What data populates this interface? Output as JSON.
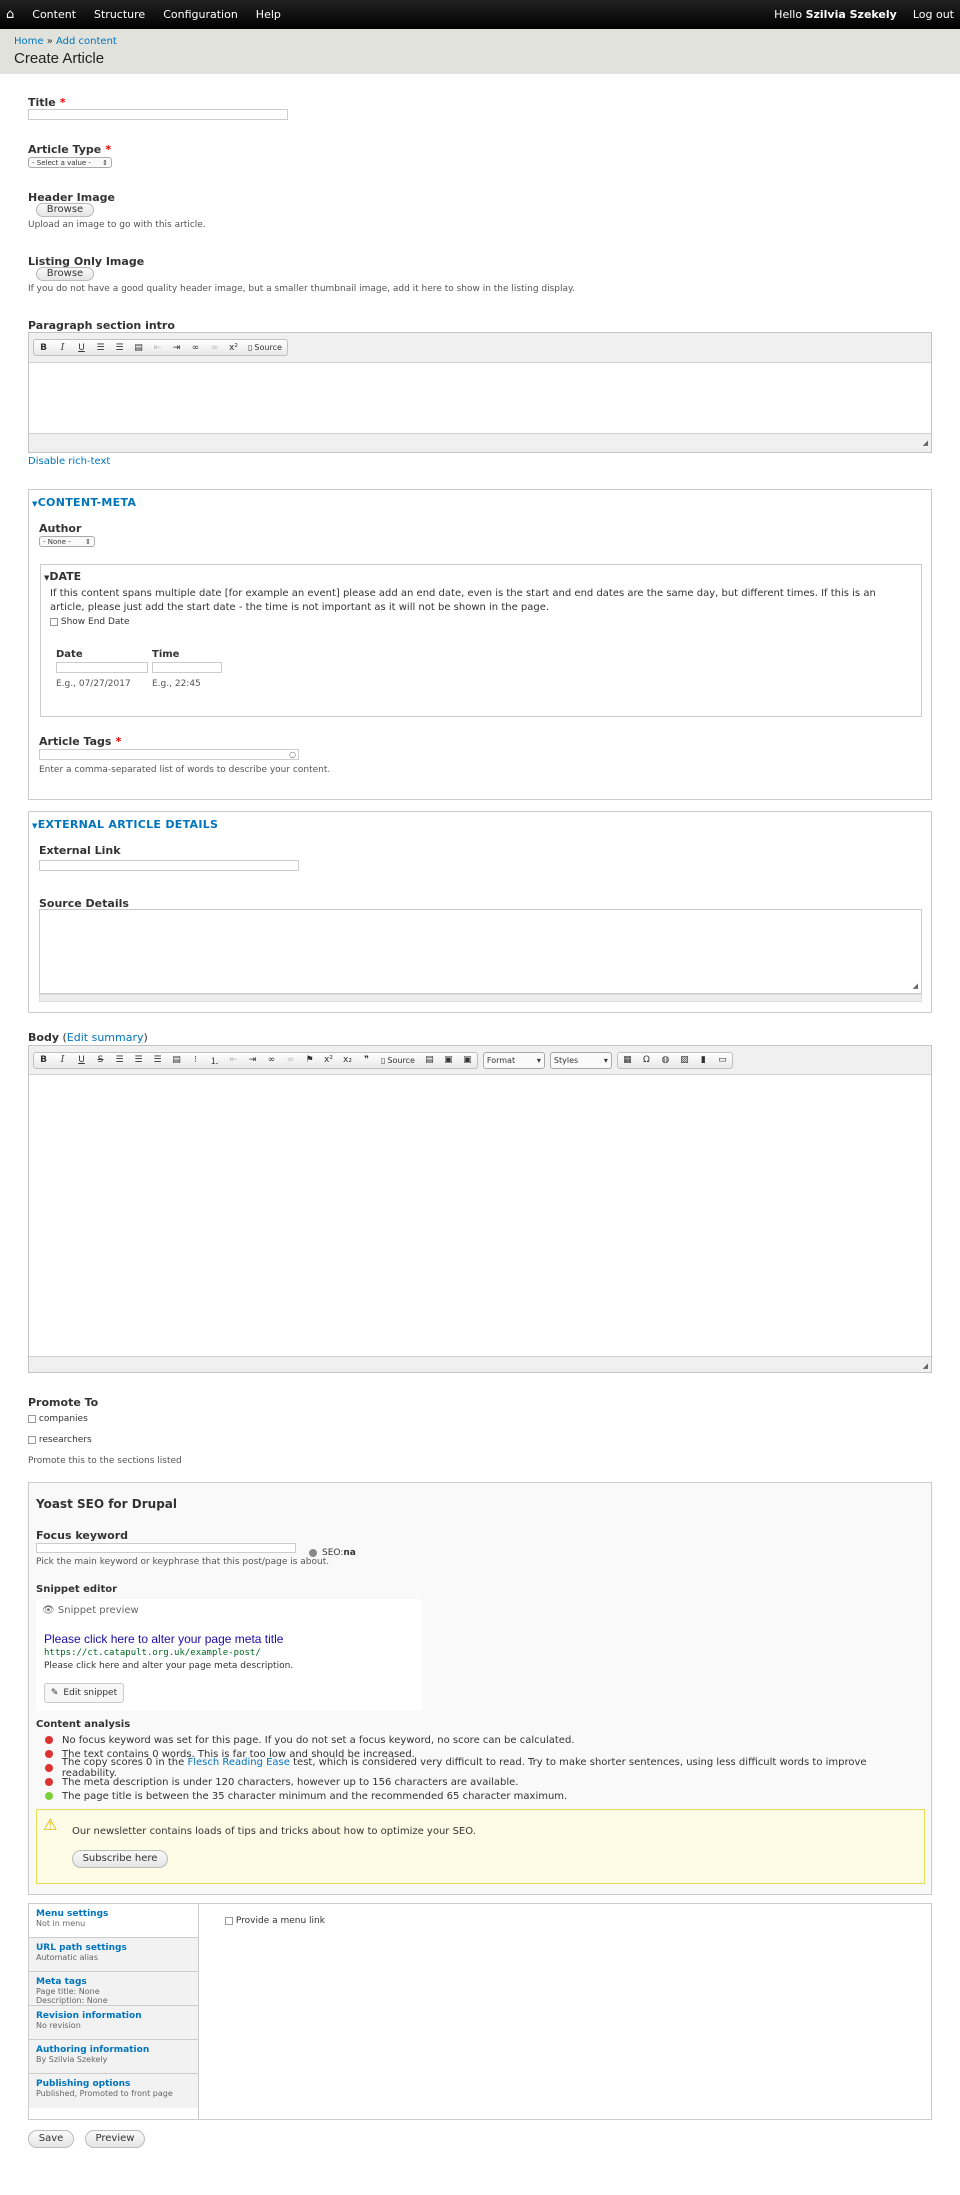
{
  "toolbar": {
    "home": "⌂",
    "items": [
      "Content",
      "Structure",
      "Configuration",
      "Help"
    ],
    "hello_prefix": "Hello ",
    "user": "Szilvia Szekely",
    "logout": "Log out"
  },
  "breadcrumb": {
    "home": "Home",
    "sep": " » ",
    "add": "Add content"
  },
  "page_title": "Create Article",
  "title_field": {
    "label": "Title",
    "req": "*"
  },
  "article_type": {
    "label": "Article Type",
    "req": "*",
    "selected": "- Select a value -"
  },
  "header_image": {
    "label": "Header Image",
    "button": "Browse",
    "desc": "Upload an image to go with this article."
  },
  "listing_image": {
    "label": "Listing Only Image",
    "button": "Browse",
    "desc": "If you do not have a good quality header image, but a smaller thumbnail image, add it here to show in the listing display."
  },
  "paragraph_intro": {
    "label": "Paragraph section intro",
    "source": "Source",
    "disable": "Disable rich-text"
  },
  "content_meta": {
    "legend": "CONTENT-META",
    "author_label": "Author",
    "author_selected": "- None -",
    "date": {
      "legend": "DATE",
      "info": "If this content spans multiple date [for example an event] please add an end date, even is the start and end dates are the same day, but different times. If this is an article, please just add the start date - the time is not important as it will not be shown in the page.",
      "show_end": "Show End Date",
      "date_label": "Date",
      "time_label": "Time",
      "date_hint": "E.g., 07/27/2017",
      "time_hint": "E.g., 22:45"
    },
    "tags_label": "Article Tags",
    "tags_req": "*",
    "tags_desc": "Enter a comma-separated list of words to describe your content."
  },
  "external": {
    "legend": "EXTERNAL ARTICLE DETAILS",
    "link_label": "External Link",
    "source_label": "Source Details"
  },
  "body": {
    "label": "Body",
    "edit_summary": "Edit summary",
    "source": "Source",
    "format": "Format",
    "styles": "Styles"
  },
  "promote": {
    "label": "Promote To",
    "options": [
      "companies",
      "researchers"
    ],
    "desc": "Promote this to the sections listed"
  },
  "seo": {
    "title": "Yoast SEO for Drupal",
    "focus_label": "Focus keyword",
    "focus_desc": "Pick the main keyword or keyphrase that this post/page is about.",
    "seo_prefix": "SEO: ",
    "seo_score": "na",
    "snippet_label": "Snippet editor",
    "snippet_preview": "Snippet preview",
    "meta_title": "Please click here to alter your page meta title",
    "url": "https://ct.catapult.org.uk/example-post/",
    "meta_desc": "Please click here and alter your page meta description.",
    "edit_snippet": "Edit snippet",
    "analysis_label": "Content analysis",
    "analysis": [
      {
        "color": "#dc3232",
        "text": "No focus keyword was set for this page. If you do not set a focus keyword, no score can be calculated."
      },
      {
        "color": "#dc3232",
        "text": "The text contains 0 words. This is far too low and should be increased."
      },
      {
        "color": "#dc3232",
        "pre": "The copy scores 0 in the ",
        "link": "Flesch Reading Ease",
        "post": " test, which is considered very difficult to read. Try to make shorter sentences, using less difficult words to improve readability."
      },
      {
        "color": "#dc3232",
        "text": "The meta description is under 120 characters, however up to 156 characters are available."
      },
      {
        "color": "#7ad03a",
        "text": "The page title is between the 35 character minimum and the recommended 65 character maximum."
      }
    ],
    "newsletter": "Our newsletter contains loads of tips and tricks about how to optimize your SEO.",
    "subscribe": "Subscribe here"
  },
  "vtabs": [
    {
      "title": "Menu settings",
      "summary": "Not in menu"
    },
    {
      "title": "URL path settings",
      "summary": "Automatic alias"
    },
    {
      "title": "Meta tags",
      "summary": "Page title: None",
      "summary2": "Description: None"
    },
    {
      "title": "Revision information",
      "summary": "No revision"
    },
    {
      "title": "Authoring information",
      "summary": "By Szilvia Szekely"
    },
    {
      "title": "Publishing options",
      "summary": "Published, Promoted to front page"
    }
  ],
  "menu_link": "Provide a menu link",
  "actions": {
    "save": "Save",
    "preview": "Preview"
  }
}
